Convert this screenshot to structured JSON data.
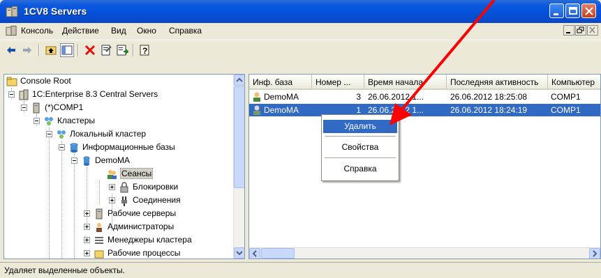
{
  "window": {
    "title": "1CV8 Servers"
  },
  "menu": {
    "items": [
      "Консоль",
      "Действие",
      "Вид",
      "Окно",
      "Справка"
    ]
  },
  "tree": {
    "items": [
      {
        "label": "Console Root"
      },
      {
        "label": "1C:Enterprise 8.3 Central Servers"
      },
      {
        "label": "(*)COMP1"
      },
      {
        "label": "Кластеры"
      },
      {
        "label": "Локальный кластер"
      },
      {
        "label": "Информационные базы"
      },
      {
        "label": "DemoMA"
      },
      {
        "label": "Сеансы"
      },
      {
        "label": "Блокировки"
      },
      {
        "label": "Соединения"
      },
      {
        "label": "Рабочие серверы"
      },
      {
        "label": "Администраторы"
      },
      {
        "label": "Менеджеры кластера"
      },
      {
        "label": "Рабочие процессы"
      }
    ],
    "selected": "Сеансы"
  },
  "table": {
    "columns": [
      "Инф. база",
      "Номер ...",
      "Время начала",
      "Последняя активность",
      "Компьютер"
    ],
    "rows": [
      {
        "base": "DemoMA",
        "num": "3",
        "start": "26.06.2012 1...",
        "last": "26.06.2012 18:25:08",
        "comp": "COMP1",
        "selected": false
      },
      {
        "base": "DemoMA",
        "num": "1",
        "start": "26.06.2012 1...",
        "last": "26.06.2012 18:24:19",
        "comp": "COMP1",
        "selected": true
      }
    ]
  },
  "context_menu": {
    "items": [
      "Удалить",
      "Свойства",
      "Справка"
    ],
    "highlighted": "Удалить"
  },
  "status": {
    "text": "Удаляет выделенные объекты."
  },
  "colors": {
    "selection": "#316ac5",
    "title_bar": "#0550d8",
    "annotation_arrow": "#ff0000"
  }
}
